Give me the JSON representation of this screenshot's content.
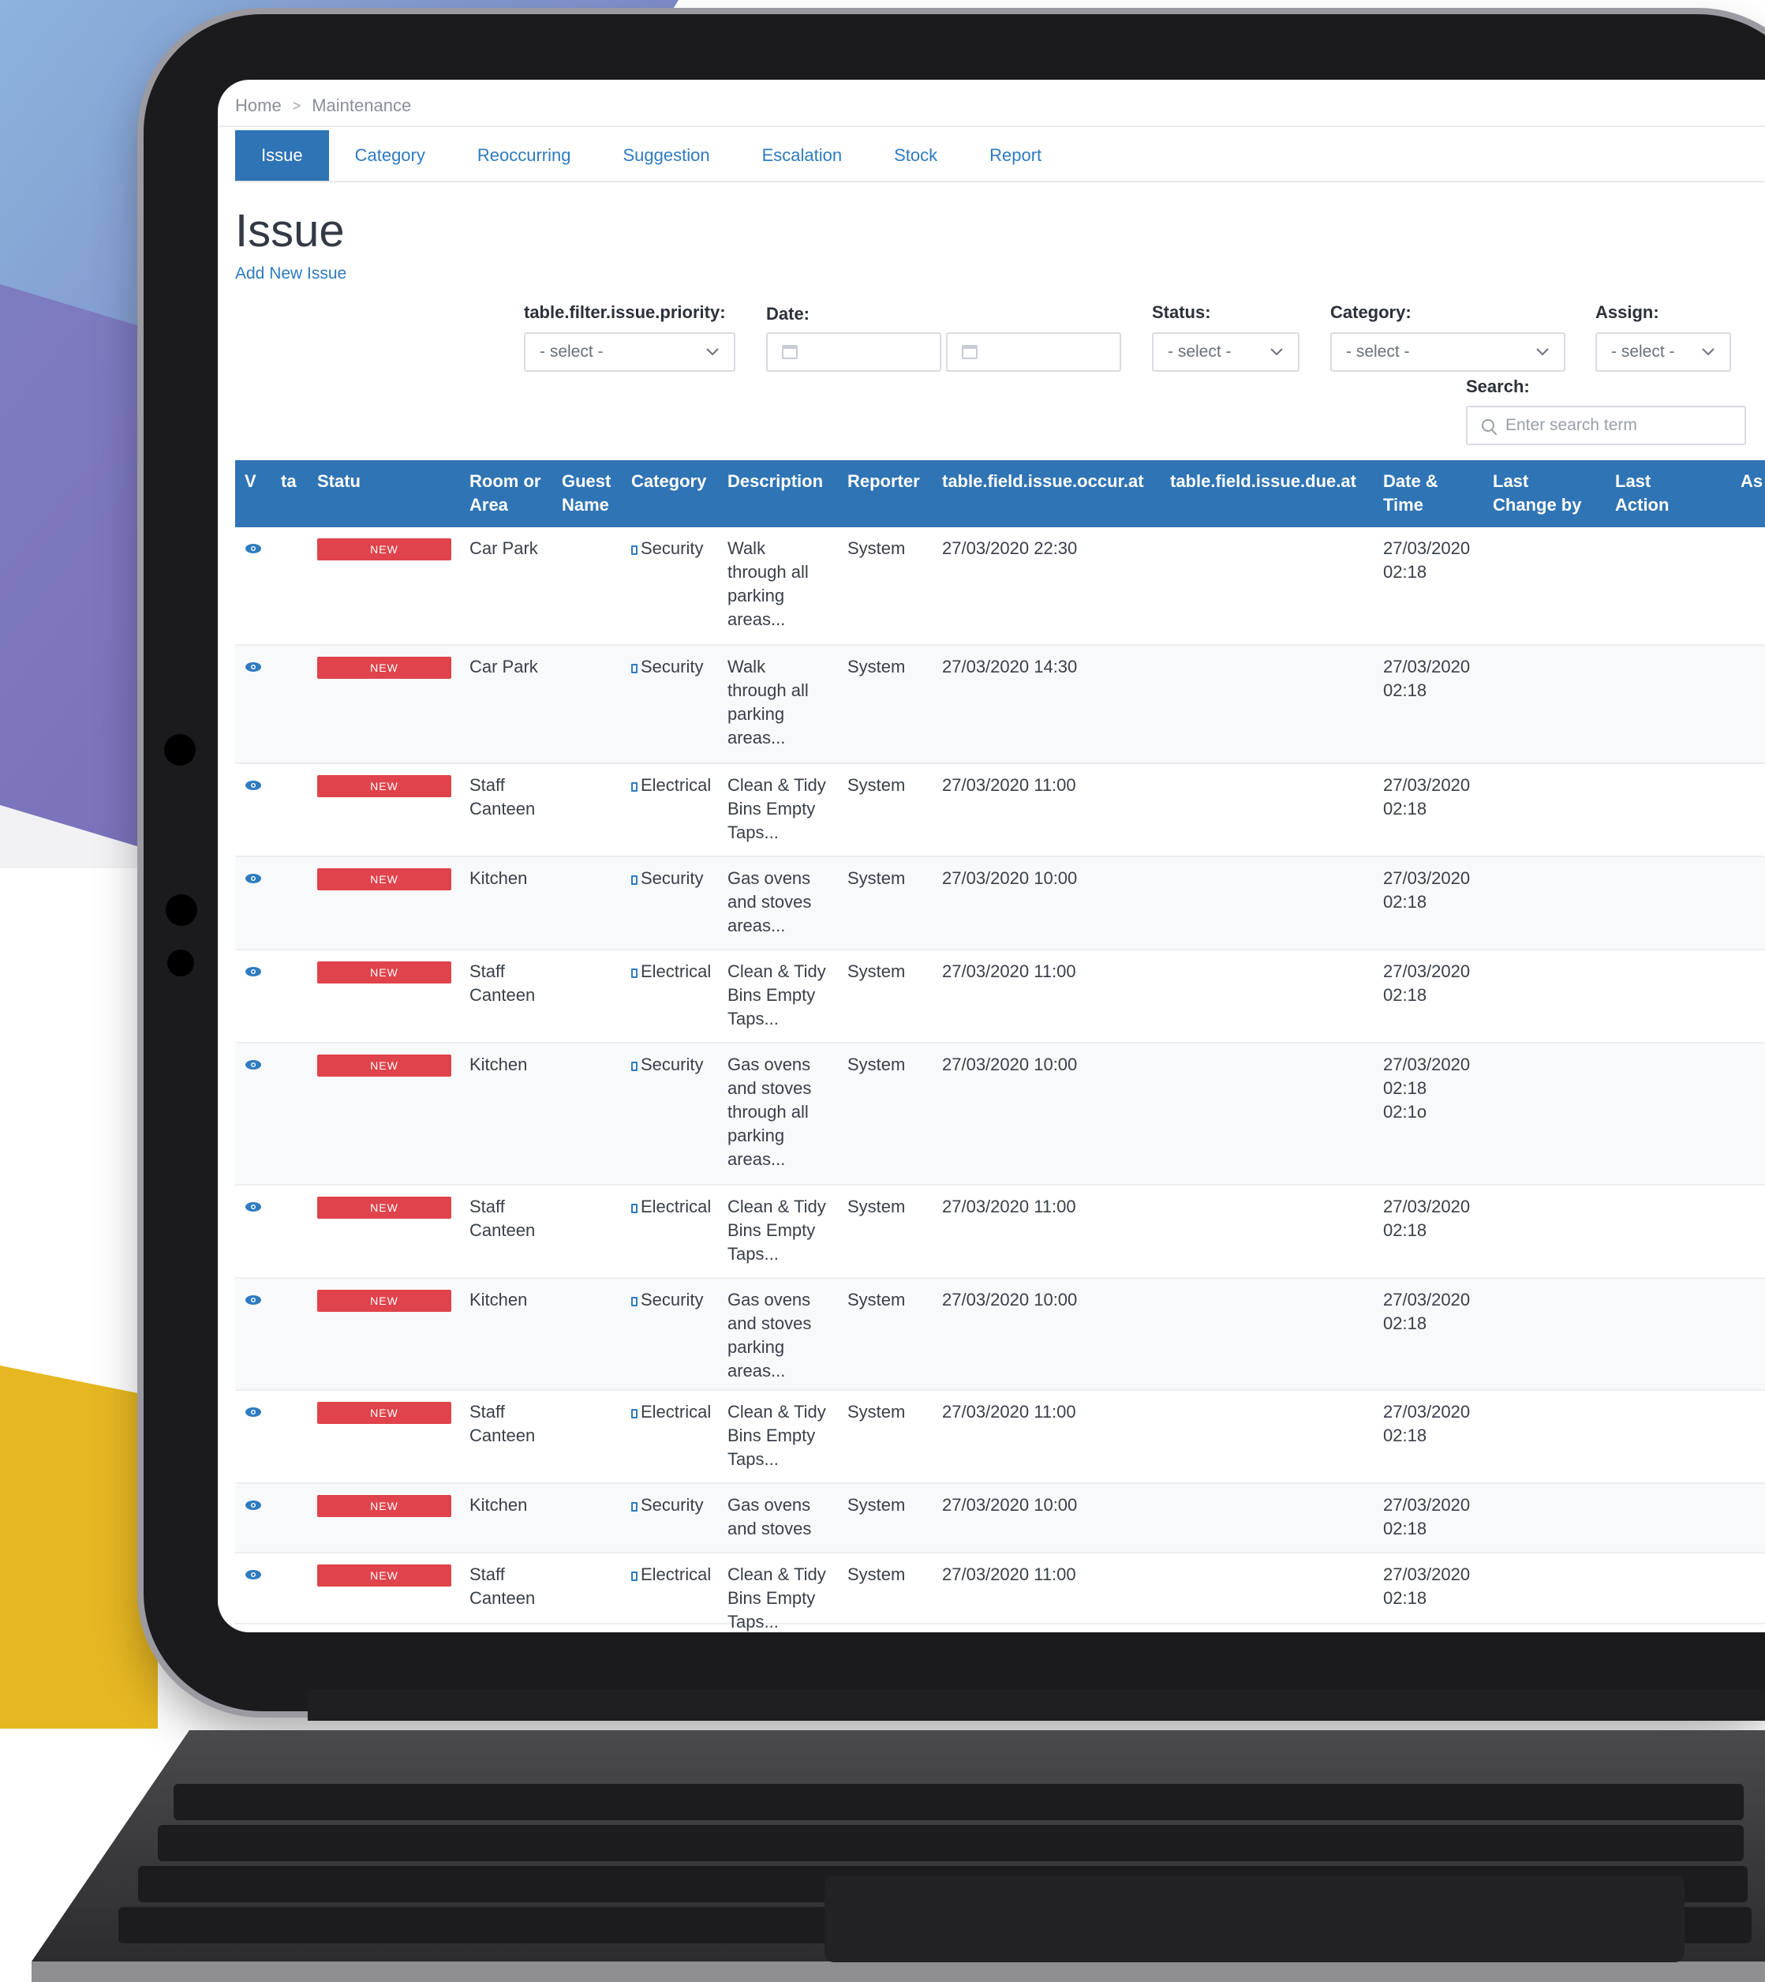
{
  "colors": {
    "accent": "#2f74b5",
    "badge": "#e0434b",
    "link": "#2e7bc0"
  },
  "breadcrumb": {
    "home": "Home",
    "sep": ">",
    "current": "Maintenance"
  },
  "tabs": [
    "Issue",
    "Category",
    "Reoccurring",
    "Suggestion",
    "Escalation",
    "Stock",
    "Report"
  ],
  "page": {
    "title": "Issue",
    "add_link": "Add New Issue"
  },
  "filters": {
    "priority_label": "table.filter.issue.priority:",
    "priority_value": "- select -",
    "date_label": "Date:",
    "status_label": "Status:",
    "status_value": "- select -",
    "category_label": "Category:",
    "category_value": "- select -",
    "assign_label": "Assign:",
    "assign_value": "- select -",
    "search_label": "Search:",
    "search_placeholder": "Enter search term"
  },
  "table": {
    "headers": [
      "V",
      "ta",
      "Statu",
      "Room or\nArea",
      "Guest\nName",
      "Category",
      "Description",
      "Reporter",
      "table.field.issue.occur.at",
      "table.field.issue.due.at",
      "Date &\nTime",
      "Last\nChange by",
      "Last\nAction",
      "As"
    ],
    "rows": [
      {
        "status": "NEW",
        "room": "Car Park",
        "category": "Security",
        "description": "Walk\nthrough all\nparking\nareas...",
        "reporter": "System",
        "occur": "27/03/2020 22:30",
        "datetime": "27/03/2020\n02:18"
      },
      {
        "status": "NEW",
        "room": "Car Park",
        "category": "Security",
        "description": "Walk\nthrough all\nparking\nareas...",
        "reporter": "System",
        "occur": "27/03/2020 14:30",
        "datetime": "27/03/2020\n02:18"
      },
      {
        "status": "NEW",
        "room": "Staff\nCanteen",
        "category": "Electrical",
        "description": "Clean & Tidy\nBins Empty\nTaps...",
        "reporter": "System",
        "occur": "27/03/2020 11:00",
        "datetime": "27/03/2020\n02:18"
      },
      {
        "status": "NEW",
        "room": "Kitchen",
        "category": "Security",
        "description": "Gas ovens\nand stoves\nareas...",
        "reporter": "System",
        "occur": "27/03/2020 10:00",
        "datetime": "27/03/2020\n02:18"
      },
      {
        "status": "NEW",
        "room": "Staff\nCanteen",
        "category": "Electrical",
        "description": "Clean & Tidy\nBins Empty\nTaps...",
        "reporter": "System",
        "occur": "27/03/2020 11:00",
        "datetime": "27/03/2020\n02:18"
      },
      {
        "status": "NEW",
        "room": "Kitchen",
        "category": "Security",
        "description": "Gas ovens\nand stoves\nthrough all\nparking\nareas...",
        "reporter": "System",
        "occur": "27/03/2020 10:00",
        "datetime": "27/03/2020\n02:18\n02:1o"
      },
      {
        "status": "NEW",
        "room": "Staff\nCanteen",
        "category": "Electrical",
        "description": "Clean & Tidy\nBins Empty\nTaps...",
        "reporter": "System",
        "occur": "27/03/2020 11:00",
        "datetime": "27/03/2020\n02:18"
      },
      {
        "status": "NEW",
        "room": "Kitchen",
        "category": "Security",
        "description": "Gas ovens\nand stoves\nparking\nareas...",
        "reporter": "System",
        "occur": "27/03/2020 10:00",
        "datetime": "27/03/2020\n02:18"
      },
      {
        "status": "NEW",
        "room": "Staff\nCanteen",
        "category": "Electrical",
        "description": "Clean & Tidy\nBins Empty\nTaps...",
        "reporter": "System",
        "occur": "27/03/2020 11:00",
        "datetime": "27/03/2020\n02:18"
      },
      {
        "status": "NEW",
        "room": "Kitchen",
        "category": "Security",
        "description": "Gas ovens\nand stoves",
        "reporter": "System",
        "occur": "27/03/2020 10:00",
        "datetime": "27/03/2020\n02:18"
      },
      {
        "status": "NEW",
        "room": "Staff\nCanteen",
        "category": "Electrical",
        "description": "Clean & Tidy\nBins Empty\nTaps...",
        "reporter": "System",
        "occur": "27/03/2020 11:00",
        "datetime": "27/03/2020\n02:18"
      }
    ]
  }
}
